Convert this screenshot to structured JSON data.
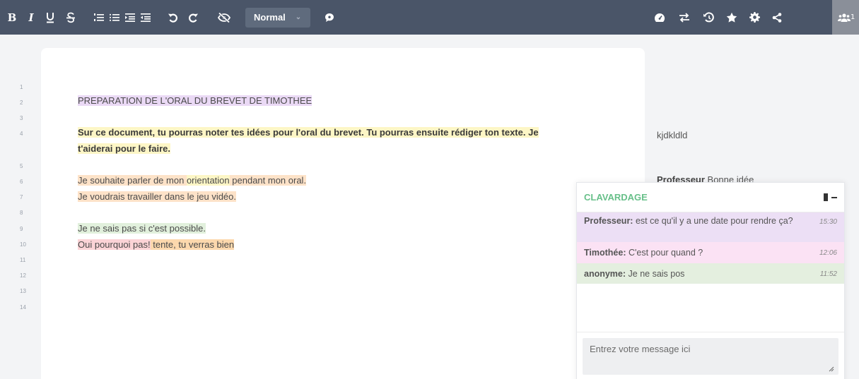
{
  "toolbar": {
    "bold": "B",
    "italic": "I",
    "style_select": "Normal",
    "user_count": "1"
  },
  "document": {
    "line_numbers": [
      "1",
      "2",
      "3",
      "4",
      "5",
      "6",
      "7",
      "8",
      "9",
      "10",
      "11",
      "12",
      "13",
      "14"
    ],
    "title": "PREPARATION DE L'ORAL DU BREVET DE TIMOTHEE",
    "intro_1": "Sur ce document, tu pourras noter tes idées pour l'oral du brevet. Tu pourras ensuite rédiger ton texte. Je",
    "intro_2": "t'aiderai pour le faire.",
    "line6_a": "Je souhaite parler de mon ",
    "line6_b": "orientation",
    "line6_c": " pendant mon oral.",
    "line7": "Je voudrais travailler dans le jeu vidéo.",
    "line9": "Je ne sais pas si c'est possible.",
    "line10_a": "Oui pourquoi pas!",
    "line10_b": " tente, tu verras bien"
  },
  "comments": {
    "c1": "kjdkldld",
    "c2_author": "Professeur",
    "c2_text": " Bonne idée"
  },
  "chat": {
    "title": "CLAVARDAGE",
    "messages": [
      {
        "author": "Professeur:",
        "text": " est ce qu'il y a une date pour rendre ça?",
        "time": "15:30"
      },
      {
        "author": "Timothée:",
        "text": " C'est pour quand ?",
        "time": "12:06"
      },
      {
        "author": "anonyme:",
        "text": " Je ne sais pos",
        "time": "11:52"
      }
    ],
    "input_placeholder": "Entrez votre message ici"
  },
  "colors": {
    "toolbar_bg": "#4a5568",
    "chat_title": "#68c08a"
  }
}
